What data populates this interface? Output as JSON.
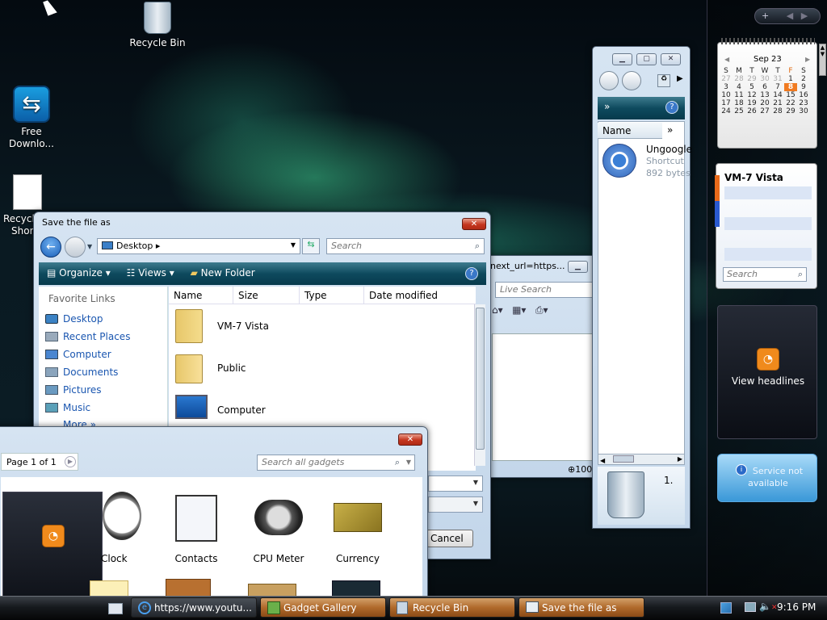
{
  "desktop": {
    "icons": [
      {
        "label": "Recycle Bin"
      },
      {
        "label_line1": "Free",
        "label_line2": "Downlo..."
      },
      {
        "label_line1": "Recycl",
        "label_line2": "Shor"
      }
    ]
  },
  "save_dialog": {
    "title": "Save the file as",
    "location": "Desktop",
    "search_placeholder": "Search",
    "toolbar": {
      "organize": "Organize",
      "views": "Views",
      "new_folder": "New Folder"
    },
    "favorite_links_header": "Favorite Links",
    "favorite_links": [
      "Desktop",
      "Recent Places",
      "Computer",
      "Documents",
      "Pictures",
      "Music"
    ],
    "more_label": "More",
    "columns": [
      "Name",
      "Size",
      "Type",
      "Date modified"
    ],
    "files": [
      "VM-7 Vista",
      "Public",
      "Computer"
    ],
    "cancel_label": "Cancel"
  },
  "browser": {
    "address_partial": "next_url=https...",
    "live_search_placeholder": "Live Search",
    "zoom_partial": "100"
  },
  "explorer_panel": {
    "column_name": "Name",
    "item_name": "Ungoogle",
    "item_type": "Shortcut",
    "item_size": "892 bytes",
    "bottom_number": "1."
  },
  "gadget_gallery": {
    "page_label": "Page 1 of 1",
    "search_placeholder": "Search all gadgets",
    "gadgets": [
      "Clock",
      "Contacts",
      "CPU Meter",
      "Currency"
    ]
  },
  "sidebar": {
    "calendar": {
      "month": "Sep 23",
      "weekdays": [
        "S",
        "M",
        "T",
        "W",
        "T",
        "F",
        "S"
      ],
      "rows": [
        [
          "27",
          "28",
          "29",
          "30",
          "31",
          "1",
          "2"
        ],
        [
          "3",
          "4",
          "5",
          "6",
          "7",
          "8",
          "9"
        ],
        [
          "10",
          "11",
          "12",
          "13",
          "14",
          "15",
          "16"
        ],
        [
          "17",
          "18",
          "19",
          "20",
          "21",
          "22",
          "23"
        ],
        [
          "24",
          "25",
          "26",
          "27",
          "28",
          "29",
          "30"
        ]
      ],
      "today": "8"
    },
    "contacts_title": "VM-7 Vista",
    "contacts_search_placeholder": "Search",
    "feed_label": "View headlines",
    "weather_label_line1": "Service not",
    "weather_label_line2": "available"
  },
  "taskbar": {
    "items": [
      "https://www.youtu...",
      "Gadget Gallery",
      "Recycle Bin",
      "Save the file as"
    ],
    "clock": "9:16 PM"
  },
  "colors": {
    "toolbar_teal": "#0e4a5e",
    "close_red": "#c4361f",
    "taskbar_orange": "#b06a2c",
    "rss_orange": "#f08a1c",
    "link_blue": "#1a56b0"
  }
}
